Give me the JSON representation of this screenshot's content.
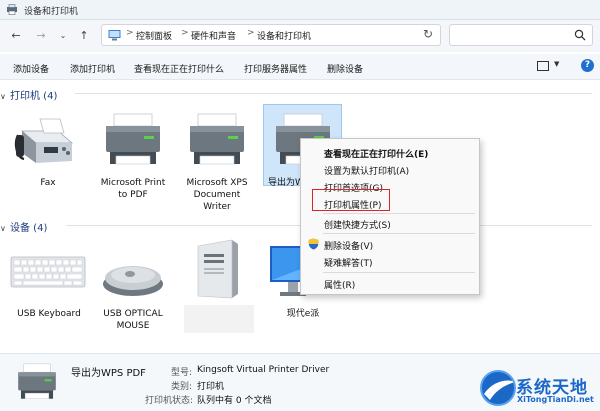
{
  "window": {
    "title": "设备和打印机"
  },
  "nav": {
    "back_icon": "arrow-left-icon",
    "forward_icon": "arrow-right-icon",
    "recent_icon": "chevron-down-icon",
    "up_icon": "arrow-up-icon"
  },
  "address": {
    "crumbs": [
      "控制面板",
      "硬件和声音",
      "设备和打印机"
    ],
    "separator": ">"
  },
  "search": {
    "placeholder": ""
  },
  "toolbar": {
    "items": [
      "添加设备",
      "添加打印机",
      "查看现在正在打印什么",
      "打印服务器属性",
      "删除设备"
    ],
    "help": "?"
  },
  "printers": {
    "header": "打印机 (4)",
    "items": [
      {
        "label": "Fax"
      },
      {
        "label": "Microsoft Print to PDF"
      },
      {
        "label": "Microsoft XPS Document Writer"
      },
      {
        "label": "导出为WPS PDF",
        "visible_label": "导出为W",
        "selected": true
      }
    ]
  },
  "devices": {
    "header": "设备 (4)",
    "items": [
      {
        "label": "USB Keyboard"
      },
      {
        "label": "USB OPTICAL MOUSE"
      },
      {
        "label": ""
      },
      {
        "label": "现代e派"
      }
    ]
  },
  "context_menu": {
    "items": [
      {
        "label": "查看现在正在打印什么(E)",
        "bold": true
      },
      {
        "label": "设置为默认打印机(A)"
      },
      {
        "label": "打印首选项(G)"
      },
      {
        "label": "打印机属性(P)",
        "highlighted": true
      },
      {
        "label": "创建快捷方式(S)"
      },
      {
        "label": "删除设备(V)",
        "icon": "uac-shield-icon"
      },
      {
        "label": "疑难解答(T)"
      },
      {
        "label": "属性(R)"
      }
    ]
  },
  "details": {
    "name": "导出为WPS PDF",
    "model_key": "型号:",
    "model_value": "Kingsoft Virtual Printer Driver",
    "category_key": "类别:",
    "category_value": "打印机",
    "status_key": "打印机状态:",
    "status_value": "队列中有 0 个文档"
  },
  "watermark": {
    "title": "系统天地",
    "url": "XiTongTianDi.net"
  },
  "colors": {
    "accent": "#1f6fd0",
    "selection": "#cfe5fa",
    "highlight_box": "#d9262d",
    "section_header": "#1e3a7a"
  }
}
